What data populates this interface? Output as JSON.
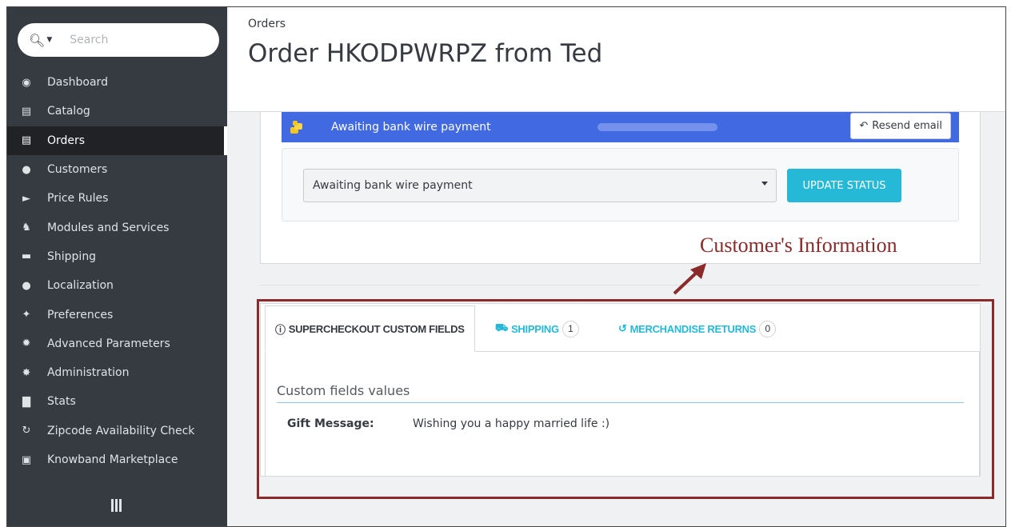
{
  "sidebar": {
    "search_placeholder": "Search",
    "items": [
      {
        "label": "Dashboard",
        "icon": "dashboard-icon"
      },
      {
        "label": "Catalog",
        "icon": "book-icon"
      },
      {
        "label": "Orders",
        "icon": "credit-card-icon",
        "active": true
      },
      {
        "label": "Customers",
        "icon": "users-icon"
      },
      {
        "label": "Price Rules",
        "icon": "tag-icon"
      },
      {
        "label": "Modules and Services",
        "icon": "puzzle-icon"
      },
      {
        "label": "Shipping",
        "icon": "truck-icon"
      },
      {
        "label": "Localization",
        "icon": "globe-icon"
      },
      {
        "label": "Preferences",
        "icon": "wrench-icon"
      },
      {
        "label": "Advanced Parameters",
        "icon": "cogs-icon"
      },
      {
        "label": "Administration",
        "icon": "gear-icon"
      },
      {
        "label": "Stats",
        "icon": "bar-chart-icon"
      },
      {
        "label": "Zipcode Availability Check",
        "icon": "refresh-icon"
      },
      {
        "label": "Knowband Marketplace",
        "icon": "archive-icon"
      }
    ]
  },
  "header": {
    "breadcrumb": "Orders",
    "title": "Order HKODPWRPZ from Ted"
  },
  "status": {
    "current": "Awaiting bank wire payment",
    "resend_label": "Resend email",
    "select_value": "Awaiting bank wire payment",
    "update_label": "UPDATE STATUS"
  },
  "annotation": {
    "text": "Customer's Information",
    "color": "#8b2a2a"
  },
  "tabs": [
    {
      "label": "SUPERCHECKOUT CUSTOM FIELDS",
      "icon": "info-circle-icon",
      "active": true
    },
    {
      "label": "SHIPPING",
      "icon": "truck-icon",
      "count": "1"
    },
    {
      "label": "MERCHANDISE RETURNS",
      "icon": "undo-icon",
      "count": "0"
    }
  ],
  "custom_fields": {
    "title": "Custom fields values",
    "rows": [
      {
        "label": "Gift Message:",
        "value": "Wishing you a happy married life :)"
      }
    ]
  },
  "colors": {
    "sidebar_bg": "#363a41",
    "status_blue": "#4169e1",
    "accent": "#25b9d7"
  }
}
